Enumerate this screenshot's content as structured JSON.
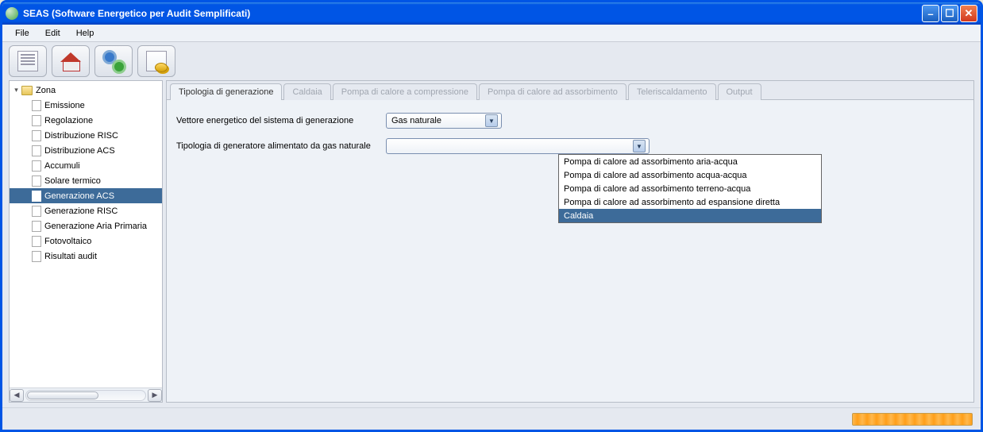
{
  "window": {
    "title": "SEAS (Software Energetico per Audit Semplificati)"
  },
  "menu": {
    "file": "File",
    "edit": "Edit",
    "help": "Help"
  },
  "tree": {
    "root": "Zona",
    "items": [
      "Emissione",
      "Regolazione",
      "Distribuzione RISC",
      "Distribuzione ACS",
      "Accumuli",
      "Solare termico",
      "Generazione ACS",
      "Generazione RISC",
      "Generazione Aria Primaria",
      "Fotovoltaico",
      "Risultati audit"
    ],
    "selected": "Generazione ACS"
  },
  "tabs": [
    "Tipologia di generazione",
    "Caldaia",
    "Pompa di calore a compressione",
    "Pompa di calore ad assorbimento",
    "Teleriscaldamento",
    "Output"
  ],
  "active_tab": "Tipologia di generazione",
  "form": {
    "vector_label": "Vettore energetico del sistema di generazione",
    "vector_value": "Gas naturale",
    "gen_type_label": "Tipologia di generatore alimentato da gas naturale",
    "gen_type_value": ""
  },
  "dropdown_options": [
    "Pompa di calore ad assorbimento aria-acqua",
    "Pompa di calore ad assorbimento acqua-acqua",
    "Pompa di calore ad assorbimento terreno-acqua",
    "Pompa di calore ad assorbimento ad espansione diretta",
    "Caldaia"
  ],
  "dropdown_highlight": "Caldaia"
}
